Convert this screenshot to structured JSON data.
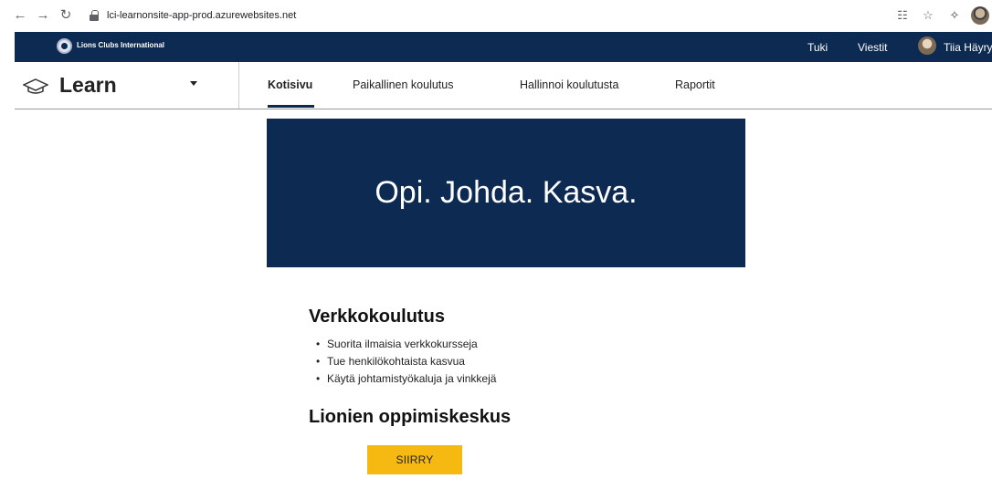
{
  "browser": {
    "url": "lci-learnonsite-app-prod.azurewebsites.net",
    "icons": [
      "back-icon",
      "forward-icon",
      "reload-icon",
      "lock-icon",
      "translate-icon",
      "star-icon",
      "extensions-icon",
      "profile-avatar"
    ]
  },
  "lions_header": {
    "org_name": "Lions Clubs International",
    "links": {
      "support": "Tuki",
      "messages": "Viestit"
    },
    "user_name": "Tiia Häyry"
  },
  "learn_nav": {
    "brand": "Learn",
    "tabs": [
      {
        "label": "Kotisivu",
        "active": true
      },
      {
        "label": "Paikallinen koulutus",
        "active": false
      },
      {
        "label": "Hallinnoi koulutusta",
        "active": false
      },
      {
        "label": "Raportit",
        "active": false
      }
    ]
  },
  "hero": {
    "text": "Opi. Johda. Kasva."
  },
  "online_training": {
    "heading": "Verkkokoulutus",
    "bullets": [
      "Suorita ilmaisia verkkokursseja",
      "Tue henkilökohtaista kasvua",
      "Käytä johtamistyökaluja ja vinkkejä"
    ]
  },
  "learning_center": {
    "heading": "Lionien oppimiskeskus",
    "button_label": "SIIRRY"
  },
  "colors": {
    "navy": "#0d2a52",
    "button_yellow": "#f6b912"
  }
}
